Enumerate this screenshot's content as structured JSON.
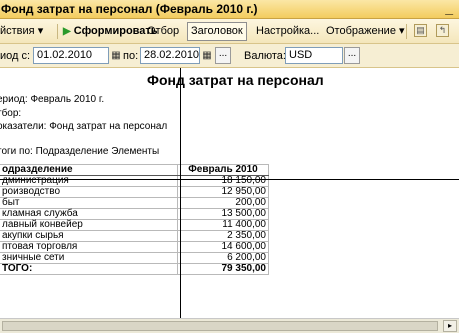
{
  "window": {
    "title": "Фонд затрат на персонал (Февраль 2010 г.)",
    "minimize": "_"
  },
  "toolbar": {
    "actions": "йствия",
    "actions_arrow": "▾",
    "generate_arrow": "▶",
    "generate": "Сформировать",
    "selection": "Отбор",
    "header": "Заголовок",
    "settings": "Настройка...",
    "display": "Отображение",
    "display_arrow": "▾"
  },
  "period": {
    "label_from": "иод с:",
    "from": "01.02.2010",
    "label_to": "по:",
    "to": "28.02.2010",
    "dots": "...",
    "currency_label": "Валюта:",
    "currency": "USD"
  },
  "report": {
    "title": "Фонд затрат на персонал",
    "period_line": "ериод: Февраль 2010 г.",
    "filter_line": "тбор:",
    "indicators_line": "оказатели: Фонд затрат на персонал",
    "totals_line": "тоги по:  Подразделение Элементы",
    "col_department": "одразделение",
    "col_month": "Февраль 2010",
    "rows": [
      {
        "name": "дминистрация",
        "value": "18 150,00"
      },
      {
        "name": "роизводство",
        "value": "12 950,00"
      },
      {
        "name": "быт",
        "value": "200,00"
      },
      {
        "name": "кламная служба",
        "value": "13 500,00"
      },
      {
        "name": "лавный конвейер",
        "value": "11 400,00"
      },
      {
        "name": "акупки сырья",
        "value": "2 350,00"
      },
      {
        "name": "птовая торговля",
        "value": "14 600,00"
      },
      {
        "name": "зничные сети",
        "value": "6 200,00"
      }
    ],
    "total_label": "ТОГО:",
    "total_value": "79 350,00"
  }
}
